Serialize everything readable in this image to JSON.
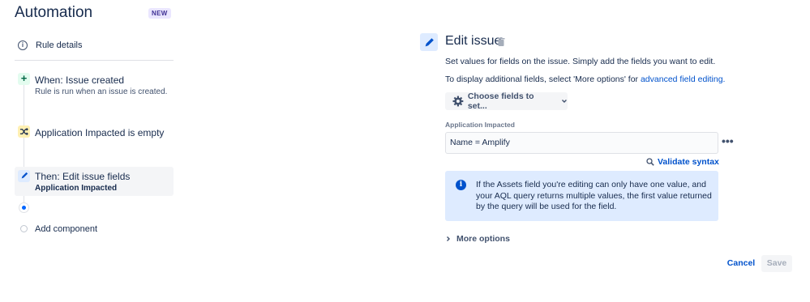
{
  "app": {
    "title": "Automation",
    "badge": "NEW"
  },
  "sidebar": {
    "rule_details": {
      "icon": "info-icon",
      "label": "Rule details"
    },
    "trigger": {
      "icon": "plus-icon",
      "title": "When: Issue created",
      "subtitle": "Rule is run when an issue is created."
    },
    "condition": {
      "icon": "shuffle-icon",
      "title": "Application Impacted is empty"
    },
    "action": {
      "icon": "pencil-icon",
      "title": "Then: Edit issue fields",
      "subtitle": "Application Impacted",
      "selected": true
    },
    "add_component": {
      "label": "Add component"
    }
  },
  "editor": {
    "title": "Edit issue",
    "description": "Set values for fields on the issue. Simply add the fields you want to edit.",
    "hint_prefix": "To display additional fields, select 'More options' for ",
    "hint_link": "advanced field editing.",
    "choose_fields_label": "Choose fields to set...",
    "field": {
      "label": "Application Impacted",
      "value": "Name = Amplify"
    },
    "more_icon": "more-horizontal-icon",
    "validate_label": "Validate syntax",
    "info_text": "If the Assets field you're editing can only have one value, and your AQL query returns multiple values, the first value returned by the query will be used for the field.",
    "more_options_label": "More options",
    "cancel_label": "Cancel",
    "save_label": "Save"
  },
  "colors": {
    "link": "#0052cc",
    "info_bg": "#deebff",
    "trigger_bg": "#e3fcef",
    "condition_bg": "#fff0b3",
    "action_bg": "#deebff",
    "badge_bg": "#eae6ff"
  }
}
